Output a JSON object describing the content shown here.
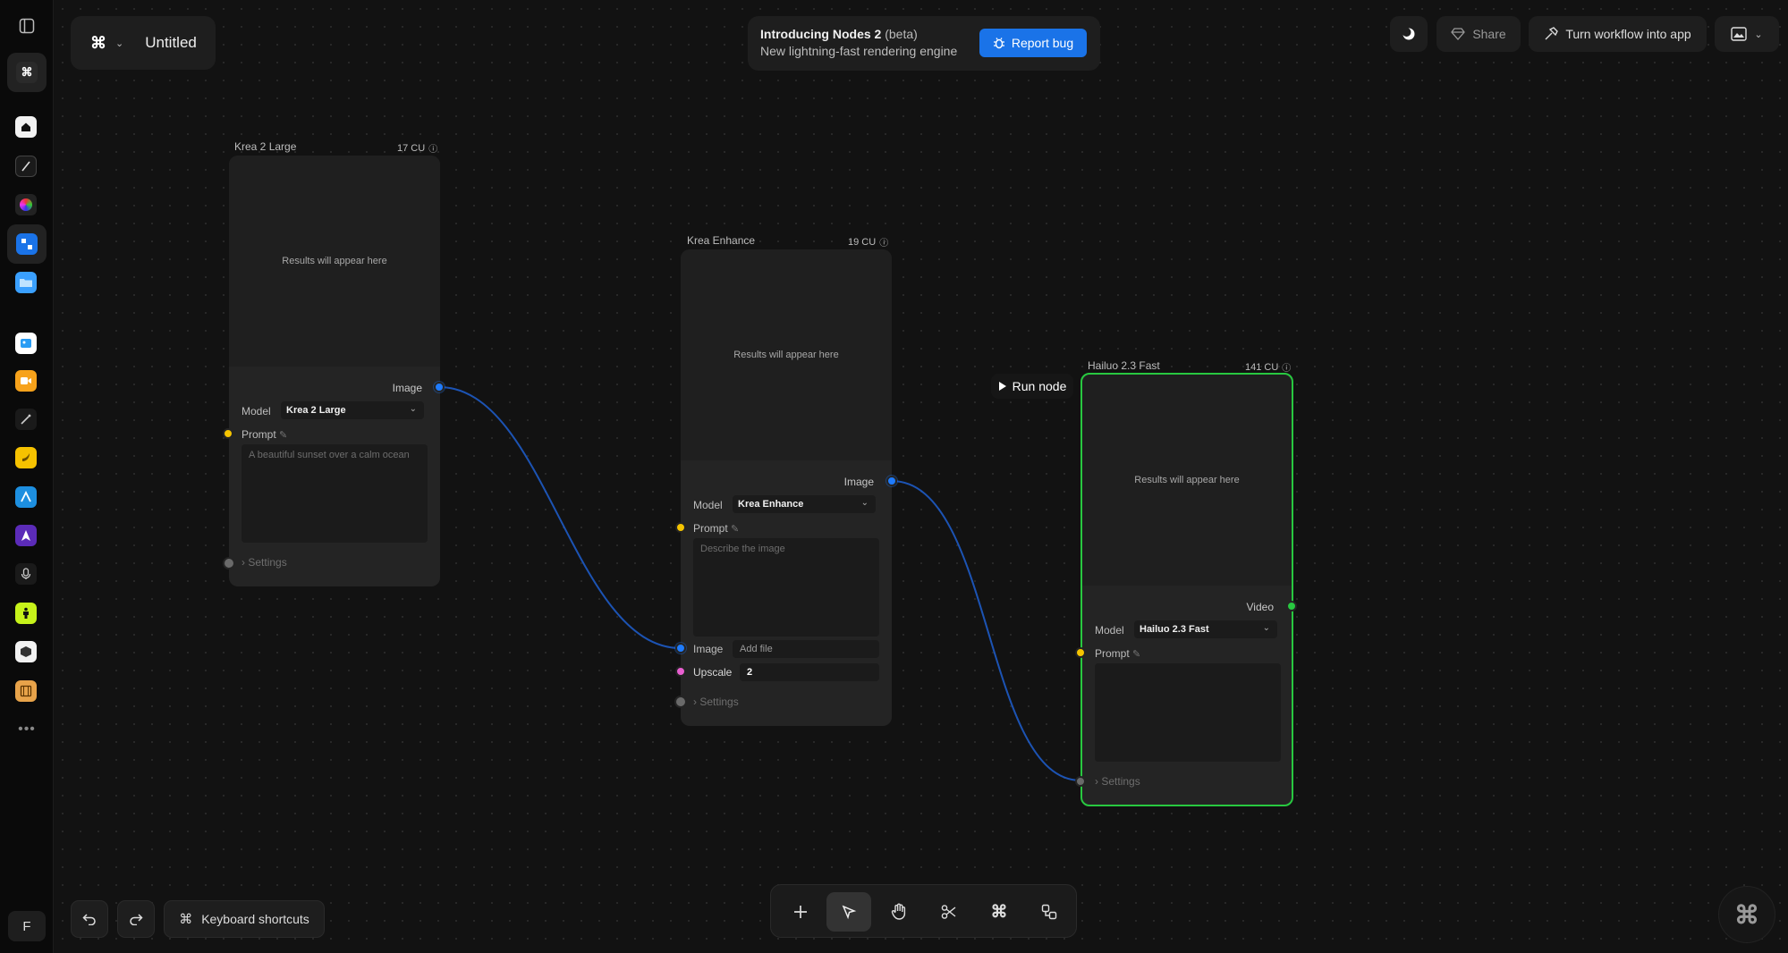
{
  "app": {
    "title": "Untitled"
  },
  "announcement": {
    "headline": "Introducing Nodes 2",
    "tag": "(beta)",
    "subtext": "New lightning-fast rendering engine",
    "button": "Report bug"
  },
  "topbar": {
    "share": "Share",
    "workflow_app": "Turn workflow into app"
  },
  "sidebar": {
    "items": [
      "home-icon",
      "pen-icon",
      "color-orb-icon",
      "nodes-icon",
      "folder-icon",
      "image-app-icon",
      "video-app-icon",
      "magic-wand-icon",
      "banana-icon",
      "arrow-app-icon",
      "compass-app-icon",
      "microphone-icon",
      "figure-icon",
      "cube-icon",
      "film-icon",
      "more-icon"
    ],
    "user_initial": "F"
  },
  "nodes": {
    "krea2": {
      "title": "Krea 2 Large",
      "cost": "17 CU",
      "placeholder_result": "Results will appear here",
      "output_label": "Image",
      "model_label": "Model",
      "model_value": "Krea 2 Large",
      "prompt_label": "Prompt",
      "prompt_placeholder": "A beautiful sunset over a calm ocean",
      "settings": "Settings"
    },
    "enhance": {
      "title": "Krea Enhance",
      "cost": "19 CU",
      "placeholder_result": "Results will appear here",
      "output_label": "Image",
      "model_label": "Model",
      "model_value": "Krea Enhance",
      "prompt_label": "Prompt",
      "prompt_placeholder": "Describe the image",
      "image_label": "Image",
      "image_value": "Add file",
      "upscale_label": "Upscale",
      "upscale_value": "2",
      "settings": "Settings"
    },
    "hailuo": {
      "title": "Hailuo 2.3 Fast",
      "cost": "141 CU",
      "placeholder_result": "Results will appear here",
      "output_label": "Video",
      "model_label": "Model",
      "model_value": "Hailuo 2.3 Fast",
      "prompt_label": "Prompt",
      "prompt_placeholder": "",
      "settings": "Settings"
    }
  },
  "run_node": "Run node",
  "bottom": {
    "keyboard_shortcuts": "Keyboard shortcuts",
    "tools": [
      "plus-icon",
      "pointer-icon",
      "hand-icon",
      "scissors-icon",
      "krea-logo-icon",
      "shapes-icon"
    ]
  },
  "colors": {
    "accent": "#1a73e8",
    "selected_border": "#28c840",
    "image_port": "#1f7cff",
    "text_port": "#f5c400",
    "number_port": "#e85fd0"
  }
}
